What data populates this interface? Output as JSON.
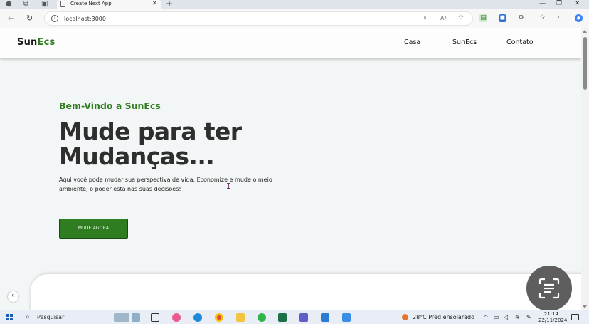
{
  "browser": {
    "tab_title": "Create Next App",
    "tab_close": "✕",
    "new_tab": "+",
    "url": "localhost:3000",
    "window_controls": [
      "—",
      "❐",
      "✕"
    ]
  },
  "site": {
    "logo_prefix": "Sun",
    "logo_accent": "Ecs",
    "nav": [
      "Casa",
      "SunEcs",
      "Contato"
    ],
    "kicker": "Bem-Vindo a SunEcs",
    "title_line1": "Mude para ter",
    "title_line2": "Mudanças...",
    "text": "Aqui você pode mudar sua perspectiva de vida. Economize e mude o meio ambiente, o poder está nas suas decisões!",
    "cta_label": "MUDE AGORA",
    "colors": {
      "brand_green": "#2f7d20",
      "title_dark": "#2e2e2e",
      "background": "#f3f6f6"
    }
  },
  "taskbar": {
    "search_placeholder": "Pesquisar",
    "weather": "28°C  Pred ensolarado",
    "time": "21:14",
    "date": "22/11/2024"
  },
  "icons": {
    "dev_badge": "ϟ",
    "cursor": "I"
  }
}
